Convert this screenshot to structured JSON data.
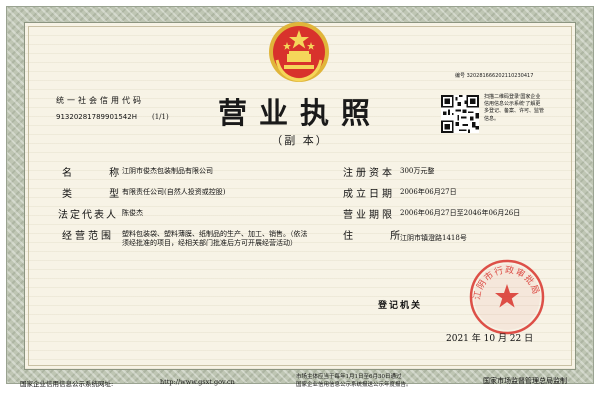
{
  "header": {
    "qr_number": "编号 320281666202110230417",
    "credit_label": "统一社会信用代码",
    "credit_code": "91320281789901542H",
    "page_no": "(1/1)",
    "title": "营业执照",
    "subtitle": "（副 本）",
    "qr_note": "扫描二维码登录'国家企业信用信息公示系统'了解更多登记、备案、许可、监管信息。"
  },
  "left_fields": [
    {
      "label": "名 称",
      "value": "江阴市俊杰包装制品有限公司"
    },
    {
      "label": "类 型",
      "value": "有限责任公司(自然人投资或控股)"
    },
    {
      "label": "法定代表人",
      "value": "陈俊杰"
    },
    {
      "label": "经营范围",
      "value_lines": [
        "塑料包装袋、塑料薄膜、纸制品的生产、加工、销售。（依法",
        "须经批准的项目，经相关部门批准后方可开展经营活动）"
      ]
    }
  ],
  "right_fields": [
    {
      "label": "注册资本",
      "value": "300万元整"
    },
    {
      "label": "成立日期",
      "value": "2006年06月27日"
    },
    {
      "label": "营业期限",
      "value": "2006年06月27日至2046年06月26日"
    },
    {
      "label": "住 所",
      "value": "江阴市镇澄路1418号"
    }
  ],
  "registration": {
    "authority_label": "登记机关",
    "date": "2021 年 10 月 22 日",
    "seal_text": "江阴市行政审批局"
  },
  "footer": {
    "left": "国家企业信用信息公示系统网址:",
    "url": "http://www.gsxt.gov.cn",
    "middle_1": "市场主体应当于每年1月1日至6月30日通过",
    "middle_2": "国家企业信用信息公示系统报送公示年度报告。",
    "right": "国家市场监督管理总局监制"
  },
  "colors": {
    "frame": "#bfc6b4",
    "paper": "#f7f3e6",
    "seal_red": "#d8322c",
    "emblem_gold": "#e0b53a"
  }
}
